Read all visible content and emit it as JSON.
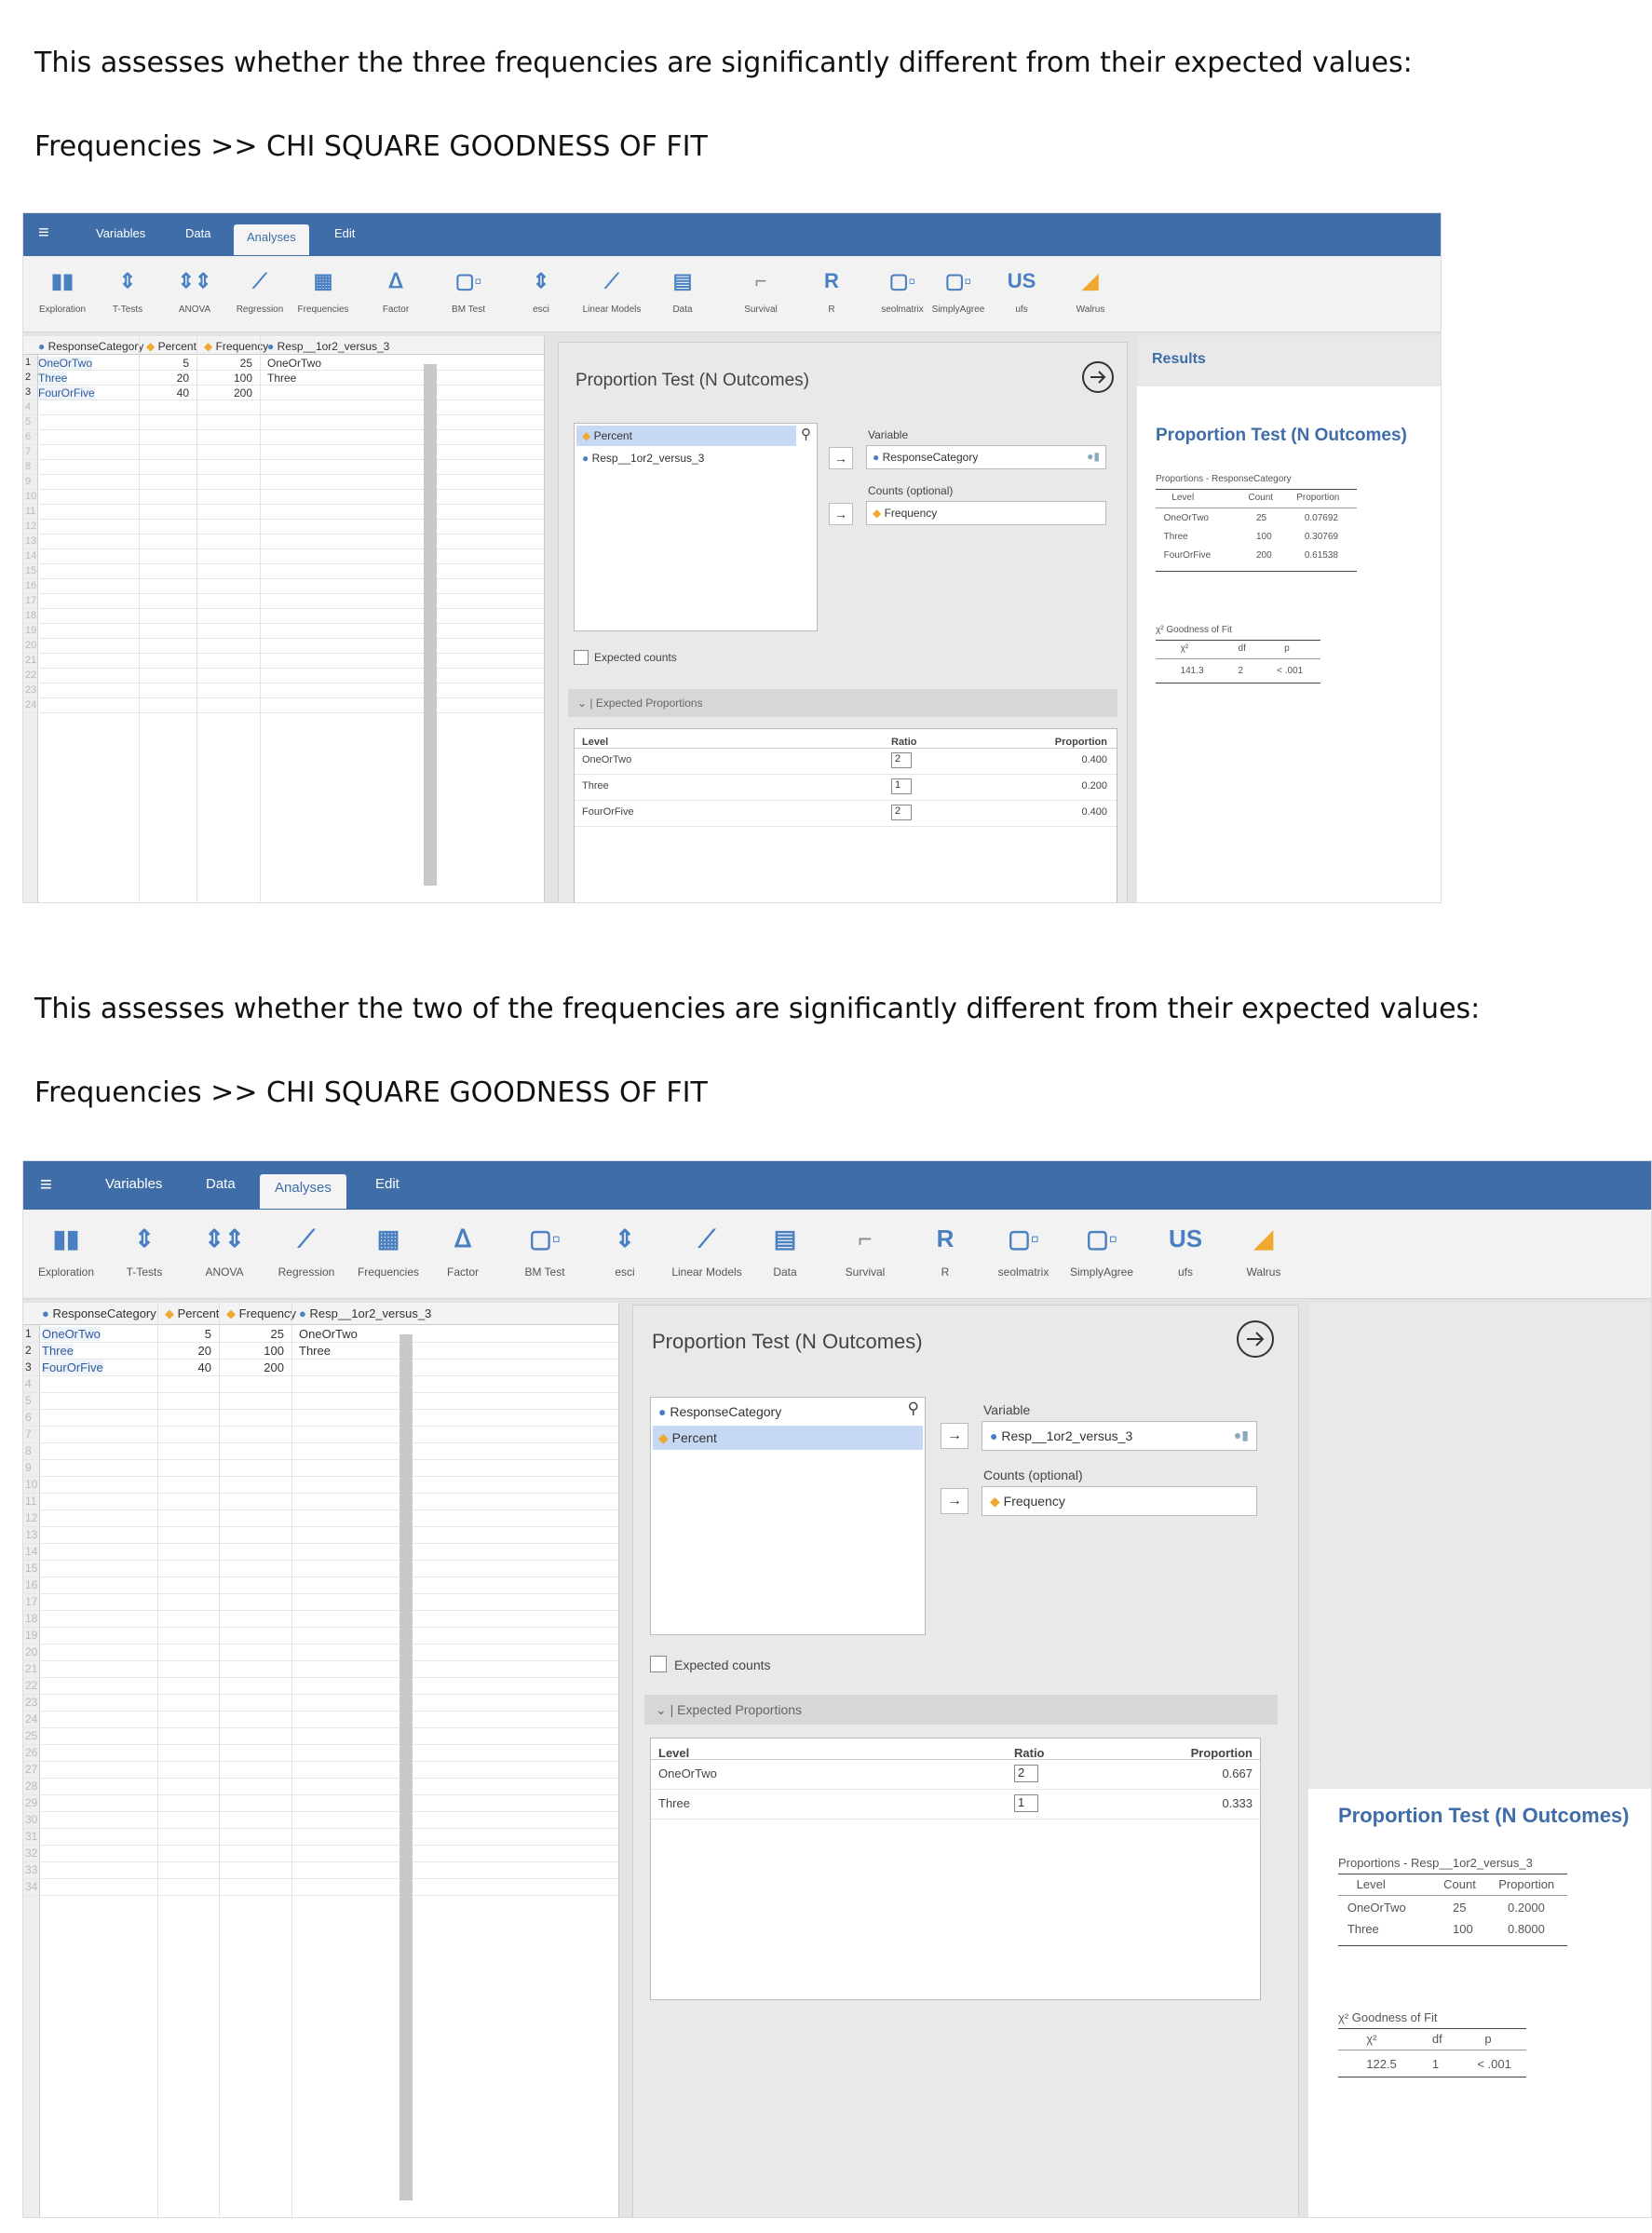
{
  "intro1": "This assesses whether the three frequencies are significantly different from their expected values:",
  "path1": "Frequencies >> CHI SQUARE GOODNESS OF FIT",
  "intro2": "This assesses whether the two of the frequencies are significantly different from their expected values:",
  "path2": "Frequencies >> CHI SQUARE GOODNESS OF FIT",
  "menu": {
    "variables": "Variables",
    "data": "Data",
    "analyses": "Analyses",
    "edit": "Edit"
  },
  "toolbar": [
    "Exploration",
    "T-Tests",
    "ANOVA",
    "Regression",
    "Frequencies",
    "Factor",
    "BM Test",
    "esci",
    "Linear Models",
    "Data",
    "Survival",
    "R",
    "seolmatrix",
    "SimplyAgree",
    "ufs",
    "Walrus"
  ],
  "sheet": {
    "columns": [
      "ResponseCategory",
      "Percent",
      "Frequency",
      "Resp__1or2_versus_3"
    ],
    "rows": [
      [
        "OneOrTwo",
        "5",
        "25",
        "OneOrTwo"
      ],
      [
        "Three",
        "20",
        "100",
        "Three"
      ],
      [
        "FourOrFive",
        "40",
        "200",
        ""
      ]
    ]
  },
  "shot1": {
    "panel_title": "Proportion Test (N Outcomes)",
    "source_vars": [
      "Percent",
      "Resp__1or2_versus_3"
    ],
    "variable_label": "Variable",
    "variable_value": "ResponseCategory",
    "counts_label": "Counts (optional)",
    "counts_value": "Frequency",
    "expected_counts": "Expected counts",
    "expected_props": "Expected Proportions",
    "table_headers": [
      "Level",
      "Ratio",
      "Proportion"
    ],
    "table_rows": [
      [
        "OneOrTwo",
        "2",
        "0.400"
      ],
      [
        "Three",
        "1",
        "0.200"
      ],
      [
        "FourOrFive",
        "2",
        "0.400"
      ]
    ],
    "results_header": "Results",
    "results_title": "Proportion Test (N Outcomes)",
    "prop_caption": "Proportions - ResponseCategory",
    "prop_headers": [
      "Level",
      "Count",
      "Proportion"
    ],
    "prop_rows": [
      [
        "OneOrTwo",
        "25",
        "0.07692"
      ],
      [
        "Three",
        "100",
        "0.30769"
      ],
      [
        "FourOrFive",
        "200",
        "0.61538"
      ]
    ],
    "gof_caption": "χ² Goodness of Fit",
    "gof_headers": [
      "χ²",
      "df",
      "p"
    ],
    "gof_row": [
      "141.3",
      "2",
      "< .001"
    ]
  },
  "shot2": {
    "panel_title": "Proportion Test (N Outcomes)",
    "source_vars": [
      "ResponseCategory",
      "Percent"
    ],
    "variable_label": "Variable",
    "variable_value": "Resp__1or2_versus_3",
    "counts_label": "Counts (optional)",
    "counts_value": "Frequency",
    "expected_counts": "Expected counts",
    "expected_props": "Expected Proportions",
    "table_headers": [
      "Level",
      "Ratio",
      "Proportion"
    ],
    "table_rows": [
      [
        "OneOrTwo",
        "2",
        "0.667"
      ],
      [
        "Three",
        "1",
        "0.333"
      ]
    ],
    "results_title": "Proportion Test (N Outcomes)",
    "prop_caption": "Proportions - Resp__1or2_versus_3",
    "prop_headers": [
      "Level",
      "Count",
      "Proportion"
    ],
    "prop_rows": [
      [
        "OneOrTwo",
        "25",
        "0.2000"
      ],
      [
        "Three",
        "100",
        "0.8000"
      ]
    ],
    "gof_caption": "χ² Goodness of Fit",
    "gof_headers": [
      "χ²",
      "df",
      "p"
    ],
    "gof_row": [
      "122.5",
      "1",
      "< .001"
    ]
  },
  "colors": {
    "menubar": "#3e6da8",
    "accent": "#3e6da8",
    "selected": "#c6d8f3",
    "icon_blue": "#4a7fc1",
    "icon_orange": "#f0a830"
  }
}
